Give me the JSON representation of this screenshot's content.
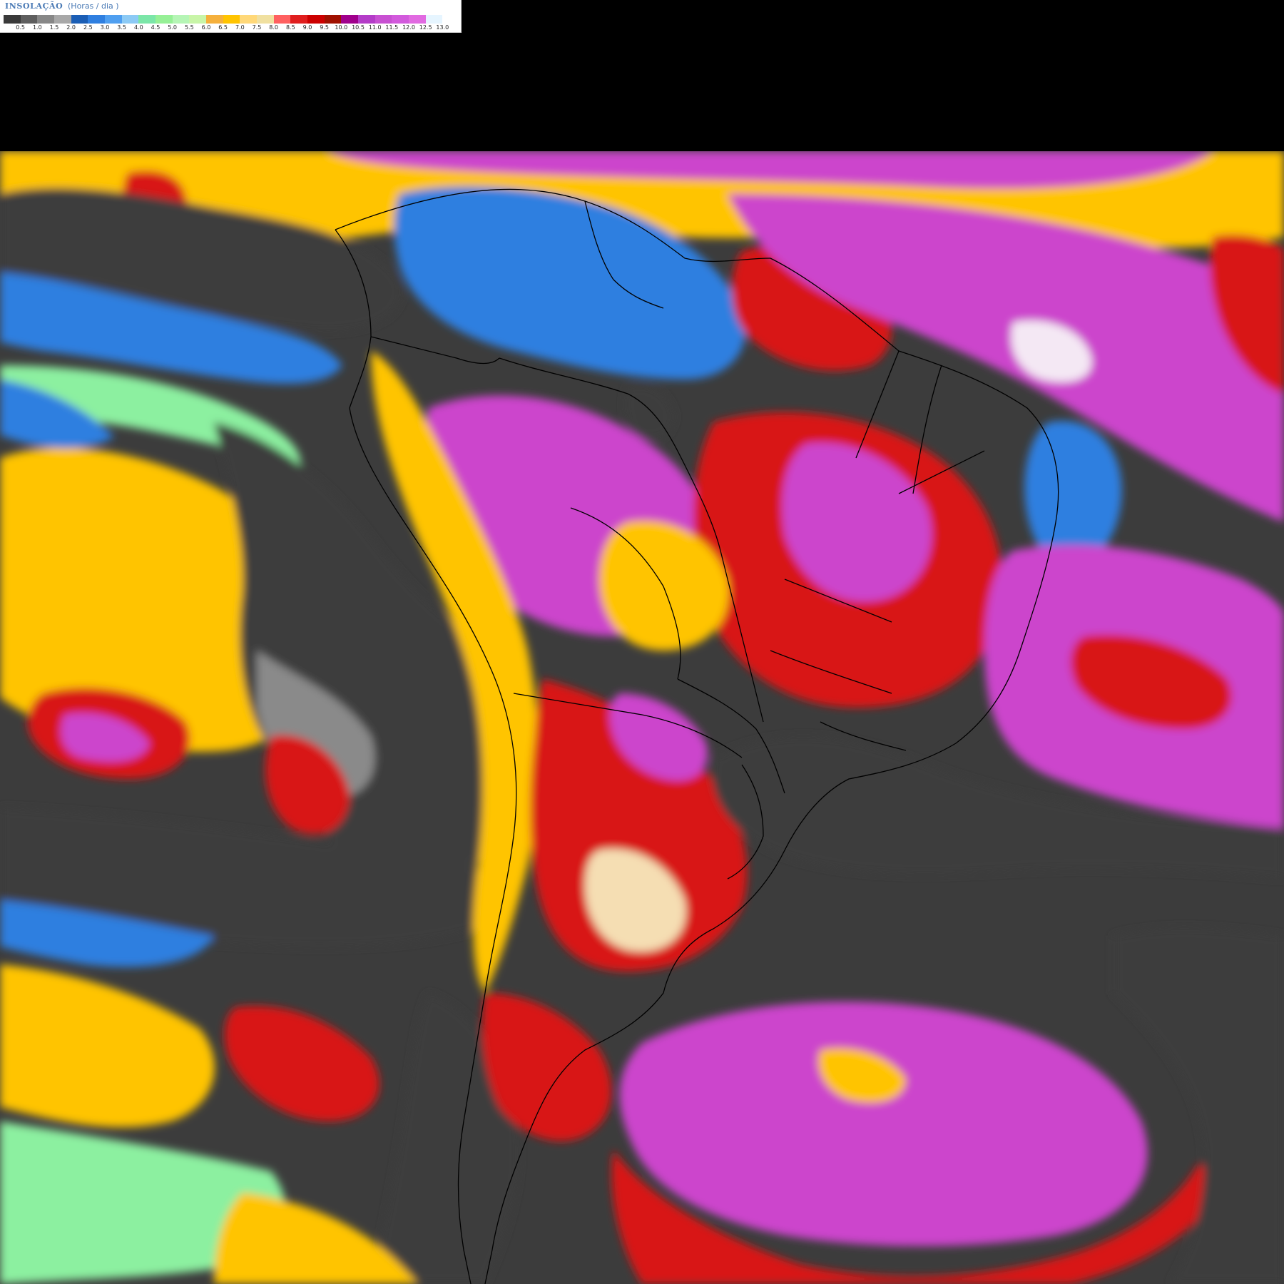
{
  "legend": {
    "title": "INSOLAÇÃO",
    "unit": "(Horas / dia )",
    "colors": [
      "#3a3a3a",
      "#5e5e5e",
      "#878787",
      "#a8a8a8",
      "#1b5eb5",
      "#2f7fe0",
      "#4f9ff0",
      "#8ccaf5",
      "#7be6a8",
      "#96f096",
      "#b5f5b5",
      "#c8f5a8",
      "#f5b03c",
      "#ffc400",
      "#ffd878",
      "#f0e0a0",
      "#ff6060",
      "#e01e1e",
      "#cc0000",
      "#a01000",
      "#a0008c",
      "#b43cc8",
      "#c850d2",
      "#d25adc",
      "#e16ae1",
      "#e6f5ff",
      "#ffffff"
    ],
    "ticks": [
      "0.5",
      "1.0",
      "1.5",
      "2.0",
      "2.5",
      "3.0",
      "3.5",
      "4.0",
      "4.5",
      "5.0",
      "5.5",
      "6.0",
      "6.5",
      "7.0",
      "7.5",
      "8.0",
      "8.5",
      "9.0",
      "9.5",
      "10.0",
      "10.5",
      "11.0",
      "11.5",
      "12.0",
      "12.5",
      "13.0"
    ]
  },
  "map": {
    "region": "south-america",
    "palette": {
      "cloud_dark": "#3c3c3c",
      "cloud_mid": "#8a8a8a",
      "low_blue": "#2f7fe0",
      "light_blue": "#8ccaf5",
      "green": "#8cf0a0",
      "yellow": "#ffc400",
      "red": "#d81818",
      "magenta": "#cc44cc",
      "border": "#000000"
    }
  }
}
